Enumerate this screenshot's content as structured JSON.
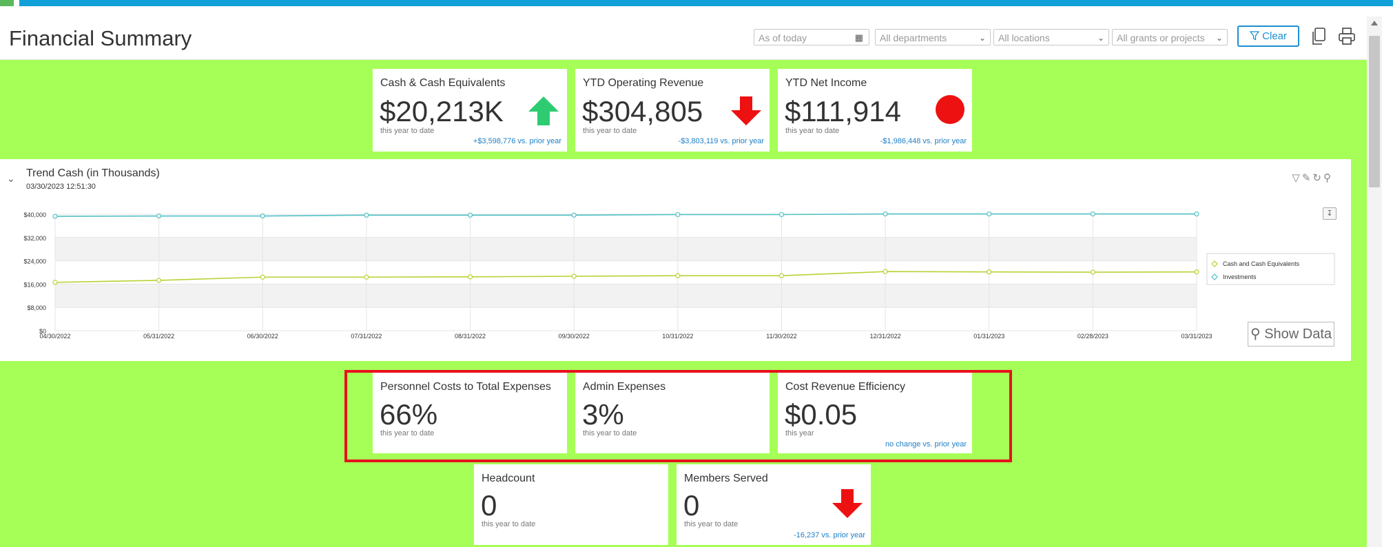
{
  "header": {
    "title": "Financial Summary",
    "date_filter_placeholder": "As of today",
    "departments": "All departments",
    "locations": "All locations",
    "grants": "All grants or projects",
    "clear_label": "Clear"
  },
  "kpis_top": [
    {
      "label": "Cash & Cash Equivalents",
      "value": "$20,213K",
      "sub": "this year to date",
      "compare": "+$3,598,776 vs. prior year",
      "indicator": "arrow-up",
      "indicator_color": "#2ecc71"
    },
    {
      "label": "YTD Operating Revenue",
      "value": "$304,805",
      "sub": "this year to date",
      "compare": "-$3,803,119 vs. prior year",
      "indicator": "arrow-down",
      "indicator_color": "#ee1111"
    },
    {
      "label": "YTD Net Income",
      "value": "$111,914",
      "sub": "this year to date",
      "compare": "-$1,986,448 vs. prior year",
      "indicator": "circle",
      "indicator_color": "#ee1111"
    }
  ],
  "trend": {
    "title": "Trend Cash (in Thousands)",
    "timestamp": "03/30/2023 12:51:30",
    "show_data_label": "Show Data"
  },
  "chart_data": {
    "type": "line",
    "x": [
      "04/30/2022",
      "05/31/2022",
      "06/30/2022",
      "07/31/2022",
      "08/31/2022",
      "09/30/2022",
      "10/31/2022",
      "11/30/2022",
      "12/31/2022",
      "01/31/2023",
      "02/28/2023",
      "03/31/2023"
    ],
    "ylim": [
      0,
      40000
    ],
    "yticks": [
      "$40,000",
      "$32,000",
      "$24,000",
      "$16,000",
      "$8,000",
      "$0"
    ],
    "grid": true,
    "legend_position": "right",
    "series": [
      {
        "name": "Cash and Cash Equivalents",
        "color": "#b5d334",
        "values": [
          16600,
          17300,
          18400,
          18400,
          18500,
          18700,
          18900,
          18900,
          20300,
          20200,
          20100,
          20200
        ]
      },
      {
        "name": "Investments",
        "color": "#4fc0c6",
        "values": [
          39300,
          39400,
          39400,
          39700,
          39700,
          39700,
          39900,
          39900,
          40100,
          40100,
          40100,
          40100
        ]
      }
    ]
  },
  "kpis_mid": [
    {
      "label": "Personnel Costs to Total Expenses",
      "value": "66%",
      "sub": "this year to date",
      "compare": ""
    },
    {
      "label": "Admin Expenses",
      "value": "3%",
      "sub": "this year to date",
      "compare": ""
    },
    {
      "label": "Cost Revenue Efficiency",
      "value": "$0.05",
      "sub": "this year",
      "compare": "no change vs. prior year"
    }
  ],
  "kpis_bottom": [
    {
      "label": "Headcount",
      "value": "0",
      "sub": "this year to date",
      "compare": ""
    },
    {
      "label": "Members Served",
      "value": "0",
      "sub": "this year to date",
      "compare": "-16,237 vs. prior year",
      "indicator": "arrow-down",
      "indicator_color": "#ee1111"
    }
  ]
}
